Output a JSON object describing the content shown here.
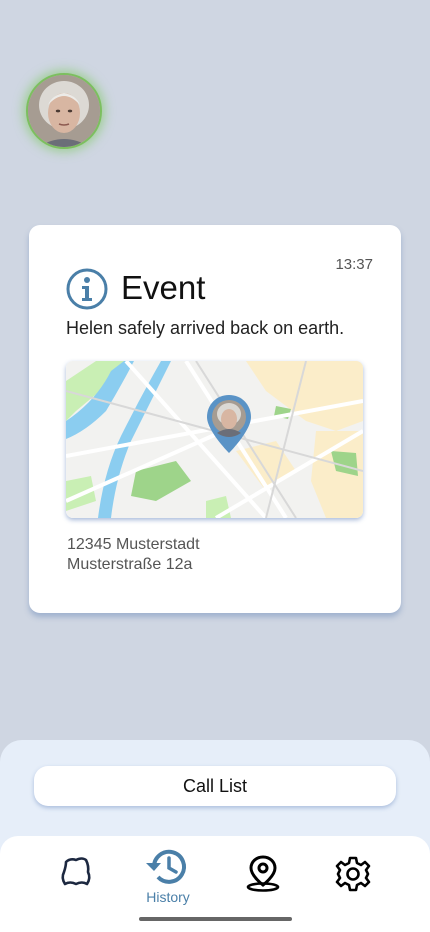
{
  "event_card": {
    "time": "13:37",
    "title": "Event",
    "description": "Helen safely arrived back on earth.",
    "address_line1": "12345 Musterstadt",
    "address_line2": "Musterstraße 12a"
  },
  "actions": {
    "call_list_label": "Call List"
  },
  "nav": {
    "history_label": "History",
    "active_color": "#4a7fa8"
  },
  "colors": {
    "background": "#cfd6e2",
    "accent": "#4a7fa8",
    "avatar_glow": "#7cbf5f"
  }
}
